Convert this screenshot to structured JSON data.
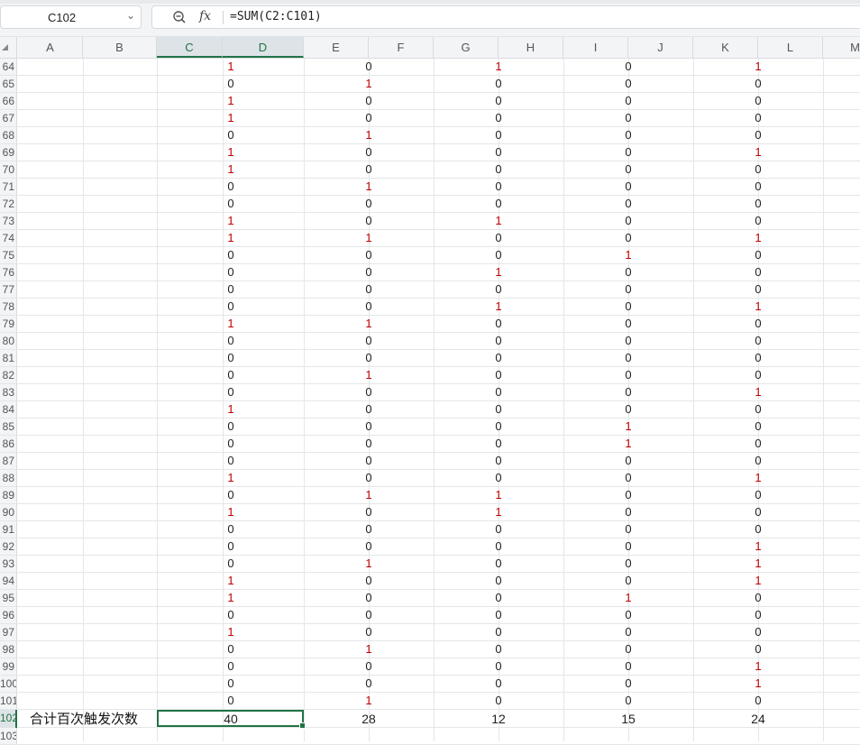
{
  "name_box": {
    "value": "C102"
  },
  "formula": {
    "text": "=SUM(C2:C101)"
  },
  "icons": {
    "zoom": "zoom-icon",
    "fx": "fx-icon",
    "dropdown": "chevron-down-icon"
  },
  "fx_label": "fx",
  "columns": [
    "A",
    "B",
    "C",
    "D",
    "E",
    "F",
    "G",
    "H",
    "I",
    "J",
    "K",
    "L",
    "M"
  ],
  "selected_column": "C",
  "rows": [
    {
      "label": "64",
      "values": [
        "1",
        "0",
        "1",
        "0",
        "1"
      ]
    },
    {
      "label": "65",
      "values": [
        "0",
        "1",
        "0",
        "0",
        "0"
      ]
    },
    {
      "label": "66",
      "values": [
        "1",
        "0",
        "0",
        "0",
        "0"
      ]
    },
    {
      "label": "67",
      "values": [
        "1",
        "0",
        "0",
        "0",
        "0"
      ]
    },
    {
      "label": "68",
      "values": [
        "0",
        "1",
        "0",
        "0",
        "0"
      ]
    },
    {
      "label": "69",
      "values": [
        "1",
        "0",
        "0",
        "0",
        "1"
      ]
    },
    {
      "label": "70",
      "values": [
        "1",
        "0",
        "0",
        "0",
        "0"
      ]
    },
    {
      "label": "71",
      "values": [
        "0",
        "1",
        "0",
        "0",
        "0"
      ]
    },
    {
      "label": "72",
      "values": [
        "0",
        "0",
        "0",
        "0",
        "0"
      ]
    },
    {
      "label": "73",
      "values": [
        "1",
        "0",
        "1",
        "0",
        "0"
      ]
    },
    {
      "label": "74",
      "values": [
        "1",
        "1",
        "0",
        "0",
        "1"
      ]
    },
    {
      "label": "75",
      "values": [
        "0",
        "0",
        "0",
        "1",
        "0"
      ]
    },
    {
      "label": "76",
      "values": [
        "0",
        "0",
        "1",
        "0",
        "0"
      ]
    },
    {
      "label": "77",
      "values": [
        "0",
        "0",
        "0",
        "0",
        "0"
      ]
    },
    {
      "label": "78",
      "values": [
        "0",
        "0",
        "1",
        "0",
        "1"
      ]
    },
    {
      "label": "79",
      "values": [
        "1",
        "1",
        "0",
        "0",
        "0"
      ]
    },
    {
      "label": "80",
      "values": [
        "0",
        "0",
        "0",
        "0",
        "0"
      ]
    },
    {
      "label": "81",
      "values": [
        "0",
        "0",
        "0",
        "0",
        "0"
      ]
    },
    {
      "label": "82",
      "values": [
        "0",
        "1",
        "0",
        "0",
        "0"
      ]
    },
    {
      "label": "83",
      "values": [
        "0",
        "0",
        "0",
        "0",
        "1"
      ]
    },
    {
      "label": "84",
      "values": [
        "1",
        "0",
        "0",
        "0",
        "0"
      ]
    },
    {
      "label": "85",
      "values": [
        "0",
        "0",
        "0",
        "1",
        "0"
      ]
    },
    {
      "label": "86",
      "values": [
        "0",
        "0",
        "0",
        "1",
        "0"
      ]
    },
    {
      "label": "87",
      "values": [
        "0",
        "0",
        "0",
        "0",
        "0"
      ]
    },
    {
      "label": "88",
      "values": [
        "1",
        "0",
        "0",
        "0",
        "1"
      ]
    },
    {
      "label": "89",
      "values": [
        "0",
        "1",
        "1",
        "0",
        "0"
      ]
    },
    {
      "label": "90",
      "values": [
        "1",
        "0",
        "1",
        "0",
        "0"
      ]
    },
    {
      "label": "91",
      "values": [
        "0",
        "0",
        "0",
        "0",
        "0"
      ]
    },
    {
      "label": "92",
      "values": [
        "0",
        "0",
        "0",
        "0",
        "1"
      ]
    },
    {
      "label": "93",
      "values": [
        "0",
        "1",
        "0",
        "0",
        "1"
      ]
    },
    {
      "label": "94",
      "values": [
        "1",
        "0",
        "0",
        "0",
        "1"
      ]
    },
    {
      "label": "95",
      "values": [
        "1",
        "0",
        "0",
        "1",
        "0"
      ]
    },
    {
      "label": "96",
      "values": [
        "0",
        "0",
        "0",
        "0",
        "0"
      ]
    },
    {
      "label": "97",
      "values": [
        "1",
        "0",
        "0",
        "0",
        "0"
      ]
    },
    {
      "label": "98",
      "values": [
        "0",
        "1",
        "0",
        "0",
        "0"
      ]
    },
    {
      "label": "99",
      "values": [
        "0",
        "0",
        "0",
        "0",
        "1"
      ]
    },
    {
      "label": "100",
      "values": [
        "0",
        "0",
        "0",
        "0",
        "1"
      ]
    },
    {
      "label": "101",
      "values": [
        "0",
        "1",
        "0",
        "0",
        "0"
      ]
    }
  ],
  "total_row": {
    "label": "102",
    "title": "合计百次触发次数",
    "values": [
      "40",
      "28",
      "12",
      "15",
      "24"
    ]
  },
  "extra_row": {
    "label": "103"
  },
  "colors": {
    "one": "#c00000",
    "accent": "#217346"
  }
}
